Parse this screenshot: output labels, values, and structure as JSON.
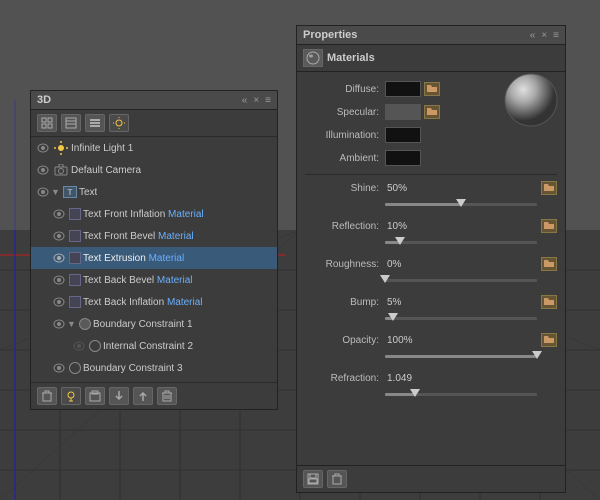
{
  "viewport": {
    "bg_color": "#4a4a4a"
  },
  "panel_3d": {
    "title": "3D",
    "header_icons": [
      "«",
      "×",
      "≡"
    ],
    "toolbar_icons": [
      "grid",
      "table",
      "layers",
      "light"
    ],
    "layers": [
      {
        "id": 1,
        "indent": 0,
        "icon": "sun",
        "name": "Infinite Light 1",
        "material": "",
        "eye": true,
        "selected": false
      },
      {
        "id": 2,
        "indent": 0,
        "icon": "cam",
        "name": "Default Camera",
        "material": "",
        "eye": true,
        "selected": false
      },
      {
        "id": 3,
        "indent": 0,
        "icon": "text",
        "name": "Text",
        "material": "",
        "eye": true,
        "selected": false,
        "expanded": true
      },
      {
        "id": 4,
        "indent": 1,
        "icon": "mat",
        "name": "Text Front Inflation ",
        "material": "Material",
        "eye": true,
        "selected": false
      },
      {
        "id": 5,
        "indent": 1,
        "icon": "mat",
        "name": "Text Front Bevel ",
        "material": "Material",
        "eye": true,
        "selected": false
      },
      {
        "id": 6,
        "indent": 1,
        "icon": "mat",
        "name": "Text Extrusion ",
        "material": "Material",
        "eye": true,
        "selected": true
      },
      {
        "id": 7,
        "indent": 1,
        "icon": "mat",
        "name": "Text Back Bevel ",
        "material": "Material",
        "eye": true,
        "selected": false
      },
      {
        "id": 8,
        "indent": 1,
        "icon": "mat",
        "name": "Text Back Inflation ",
        "material": "Material",
        "eye": true,
        "selected": false
      },
      {
        "id": 9,
        "indent": 1,
        "icon": "constraint",
        "name": "Boundary Constraint 1",
        "material": "",
        "eye": true,
        "selected": false,
        "expanded": true
      },
      {
        "id": 10,
        "indent": 2,
        "icon": "constraint-inner",
        "name": "Internal Constraint 2",
        "material": "",
        "eye": false,
        "selected": false
      },
      {
        "id": 11,
        "indent": 1,
        "icon": "constraint",
        "name": "Boundary Constraint 3",
        "material": "",
        "eye": true,
        "selected": false
      }
    ],
    "footer_icons": [
      "trash",
      "light",
      "new-layer",
      "arrow-down",
      "arrow-up",
      "delete"
    ]
  },
  "panel_properties": {
    "title": "Properties",
    "tab_icon": "material-sphere",
    "tab_label": "Materials",
    "sphere_preview": true,
    "material_rows": [
      {
        "label": "Diffuse:",
        "swatch": "black",
        "has_folder": true
      },
      {
        "label": "Specular:",
        "swatch": "gray",
        "has_folder": true
      },
      {
        "label": "Illumination:",
        "swatch": "black",
        "has_folder": false
      },
      {
        "label": "Ambient:",
        "swatch": "black",
        "has_folder": false
      }
    ],
    "sliders": [
      {
        "label": "Shine:",
        "value": "50%",
        "fill_pct": 50,
        "thumb_pct": 50,
        "has_folder": true
      },
      {
        "label": "Reflection:",
        "value": "10%",
        "fill_pct": 10,
        "thumb_pct": 10,
        "has_folder": true
      },
      {
        "label": "Roughness:",
        "value": "0%",
        "fill_pct": 0,
        "thumb_pct": 0,
        "has_folder": true
      },
      {
        "label": "Bump:",
        "value": "5%",
        "fill_pct": 5,
        "thumb_pct": 5,
        "has_folder": true
      },
      {
        "label": "Opacity:",
        "value": "100%",
        "fill_pct": 100,
        "thumb_pct": 100,
        "has_folder": true
      },
      {
        "label": "Refraction:",
        "value": "1.049",
        "fill_pct": 20,
        "thumb_pct": 20,
        "has_folder": false
      }
    ],
    "footer_icons": [
      "save",
      "delete"
    ]
  }
}
